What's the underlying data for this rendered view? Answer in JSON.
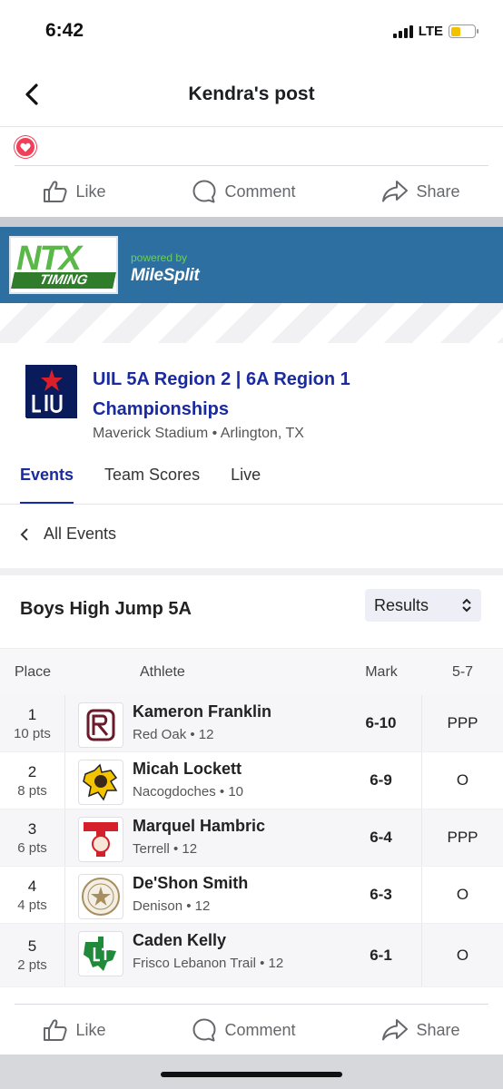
{
  "status": {
    "time": "6:42",
    "network": "LTE",
    "battery_color": "#f2c200"
  },
  "header": {
    "title": "Kendra's post",
    "back_icon": "chevron-left-icon"
  },
  "reactions": {
    "icon": "heart-icon",
    "color": "#f33e58"
  },
  "actions": {
    "like": "Like",
    "comment": "Comment",
    "share": "Share"
  },
  "banner": {
    "ntx_top": "NTX",
    "ntx_bottom": "TIMING",
    "powered_by": "powered by",
    "brand": "MileSplit",
    "background": "#2d6fa0"
  },
  "meet": {
    "title": "UIL 5A Region 2 | 6A Region 1 Championships",
    "location": "Maverick Stadium • Arlington, TX",
    "accent": "#1a2aa0"
  },
  "tabs": [
    {
      "label": "Events",
      "active": true
    },
    {
      "label": "Team Scores",
      "active": false
    },
    {
      "label": "Live",
      "active": false
    }
  ],
  "all_events": "All Events",
  "event": {
    "title": "Boys High Jump 5A",
    "view_select": "Results"
  },
  "table": {
    "headers": {
      "place": "Place",
      "athlete": "Athlete",
      "mark": "Mark",
      "attempt": "5-7"
    },
    "rows": [
      {
        "place": "1",
        "pts": "10 pts",
        "name": "Kameron Franklin",
        "team": "Red Oak • 12",
        "mark": "6-10",
        "attempt": "PPP"
      },
      {
        "place": "2",
        "pts": "8 pts",
        "name": "Micah Lockett",
        "team": "Nacogdoches • 10",
        "mark": "6-9",
        "attempt": "O"
      },
      {
        "place": "3",
        "pts": "6 pts",
        "name": "Marquel Hambric",
        "team": "Terrell • 12",
        "mark": "6-4",
        "attempt": "PPP"
      },
      {
        "place": "4",
        "pts": "4 pts",
        "name": "De'Shon Smith",
        "team": "Denison • 12",
        "mark": "6-3",
        "attempt": "O"
      },
      {
        "place": "5",
        "pts": "2 pts",
        "name": "Caden Kelly",
        "team": "Frisco Lebanon Trail • 12",
        "mark": "6-1",
        "attempt": "O"
      }
    ]
  }
}
